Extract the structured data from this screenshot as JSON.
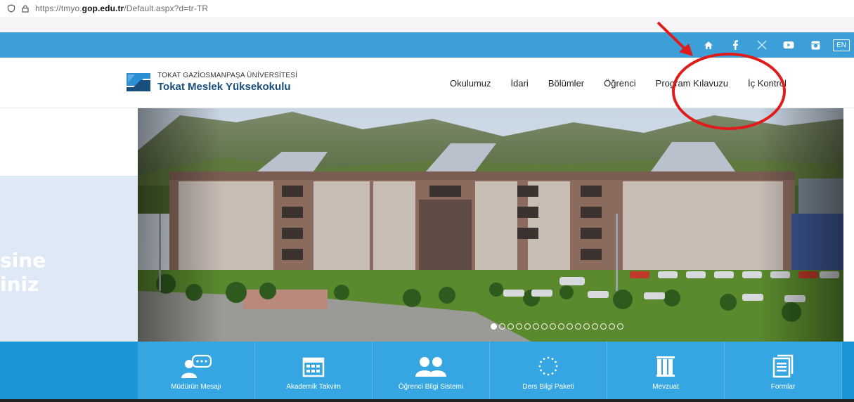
{
  "browser": {
    "url_prefix": "https://tmyo.",
    "url_domain": "gop.edu.tr",
    "url_suffix": "/Default.aspx?d=tr-TR"
  },
  "topbar": {
    "icons": [
      "home-icon",
      "facebook-icon",
      "x-icon",
      "youtube-icon",
      "instagram-icon"
    ],
    "lang": "EN"
  },
  "logo": {
    "line1": "TOKAT GAZİOSMANPAŞA ÜNİVERSİTESİ",
    "line2": "Tokat Meslek Yüksekokulu"
  },
  "nav": [
    "Okulumuz",
    "İdari",
    "Bölümler",
    "Öğrenci",
    "Program Kılavuzu",
    "İç Kontrol"
  ],
  "slogan": [
    "sine",
    "iniz"
  ],
  "slider": {
    "dot_count": 16,
    "active_index": 0
  },
  "quick_links": [
    {
      "label": "Müdürün Mesajı",
      "icon": "message-icon"
    },
    {
      "label": "Akademik Takvim",
      "icon": "calendar-icon"
    },
    {
      "label": "Öğrenci Bilgi Sistemi",
      "icon": "students-icon"
    },
    {
      "label": "Ders Bilgi Paketi",
      "icon": "eu-stars-icon"
    },
    {
      "label": "Mevzuat",
      "icon": "books-icon"
    },
    {
      "label": "Formlar",
      "icon": "forms-icon"
    }
  ],
  "colors": {
    "topbar": "#3d9fd8",
    "quickbar": "#1c95d6",
    "annotation": "#e11a1a"
  }
}
